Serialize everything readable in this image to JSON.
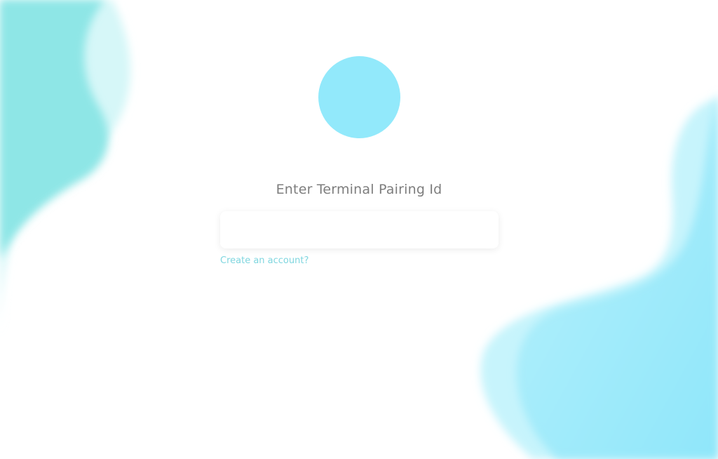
{
  "login": {
    "heading": "Enter Terminal Pairing Id",
    "input_value": "",
    "create_account_link": "Create an account?"
  },
  "colors": {
    "accent": "#92e9fb",
    "link": "#7fd6df",
    "shape_left": "#8ee6e6",
    "shape_right": "#92e9fb"
  }
}
